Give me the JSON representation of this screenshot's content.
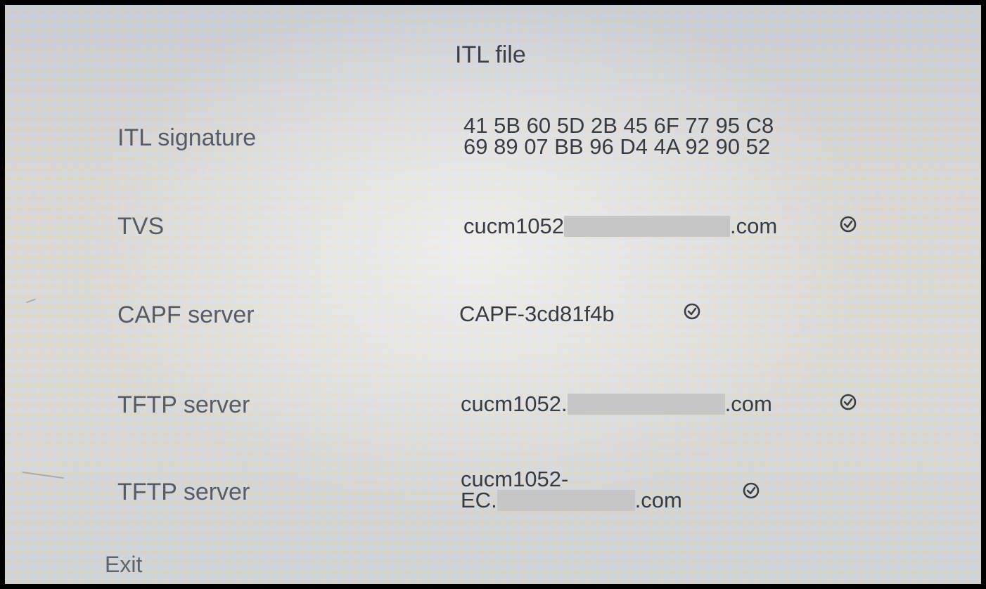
{
  "title": "ITL file",
  "rows": [
    {
      "label": "ITL signature",
      "value_lines": [
        "41 5B 60 5D 2B 45 6F 77 95 C8",
        "69 89 07 BB 96 D4 4A 92 90 52"
      ]
    },
    {
      "label": "TVS",
      "value_prefix": "cucm1052",
      "value_suffix": ".com",
      "redacted": true,
      "status_icon": "check-circle-icon"
    },
    {
      "label": "CAPF server",
      "value": "CAPF-3cd81f4b",
      "status_icon": "check-circle-icon"
    },
    {
      "label": "TFTP server",
      "value_prefix": "cucm1052.",
      "value_suffix": ".com",
      "redacted": true,
      "status_icon": "check-circle-icon"
    },
    {
      "label": "TFTP server",
      "value_line1": "cucm1052-",
      "value_prefix": "EC.",
      "value_suffix": ".com",
      "redacted": true,
      "status_icon": "check-circle-icon"
    }
  ],
  "exit_label": "Exit",
  "colors": {
    "text_primary": "#383b45",
    "text_label": "#565b67",
    "redaction": "#c6c6c6"
  }
}
